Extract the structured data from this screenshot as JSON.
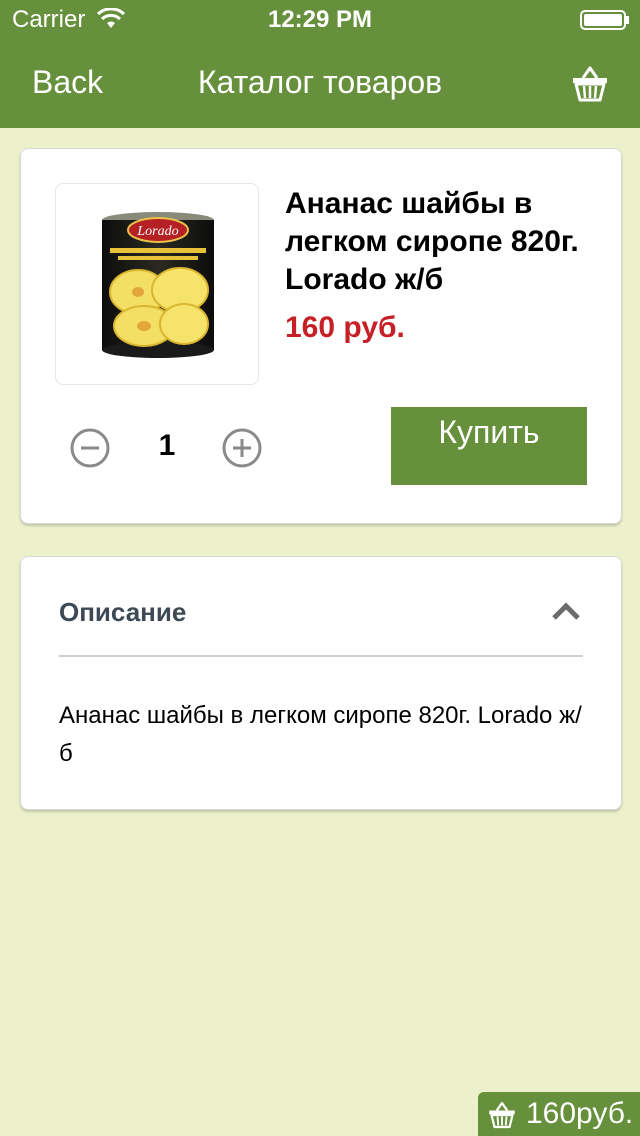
{
  "status_bar": {
    "carrier": "Carrier",
    "time": "12:29 PM"
  },
  "nav": {
    "back_label": "Back",
    "title": "Каталог товаров",
    "cart_icon": "basket-icon"
  },
  "product": {
    "title": "Ананас шайбы в легком сиропе 820г. Lorado ж/б",
    "price": "160 руб.",
    "image_brand": "Lorado",
    "quantity": "1",
    "buy_label": "Купить"
  },
  "description": {
    "header": "Описание",
    "text": "Ананас шайбы в легком сиропе 820г. Lorado ж/б"
  },
  "cart_summary": {
    "total": "160руб."
  },
  "colors": {
    "accent_green": "#66903c",
    "background": "#edf1cb",
    "price_red": "#c62026"
  }
}
